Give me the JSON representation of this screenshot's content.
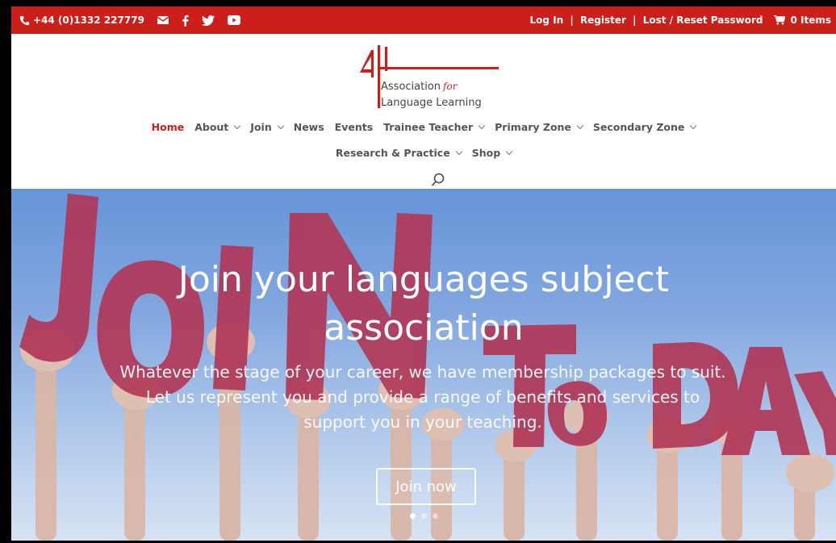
{
  "topbar": {
    "phone": "+44 (0)1332 227779",
    "social_icons": [
      "envelope-icon",
      "facebook-icon",
      "twitter-icon",
      "youtube-icon"
    ],
    "login": "Log In",
    "register": "Register",
    "reset": "Lost / Reset Password",
    "separator": "|",
    "cart_label": "0 Items",
    "bg_color": "#cc1f1a"
  },
  "logo": {
    "line1": "Association",
    "line1_for": "for",
    "line2": "Language Learning"
  },
  "nav": {
    "row1": [
      {
        "label": "Home",
        "active": true,
        "dropdown": false
      },
      {
        "label": "About",
        "dropdown": true
      },
      {
        "label": "Join",
        "dropdown": true
      },
      {
        "label": "News",
        "dropdown": false
      },
      {
        "label": "Events",
        "dropdown": false
      },
      {
        "label": "Trainee Teacher",
        "dropdown": true
      },
      {
        "label": "Primary Zone",
        "dropdown": true
      },
      {
        "label": "Secondary Zone",
        "dropdown": true
      }
    ],
    "row2": [
      {
        "label": "Research & Practice",
        "dropdown": true
      },
      {
        "label": "Shop",
        "dropdown": true
      }
    ],
    "search_icon": "search-icon",
    "active_color": "#cc1f1a"
  },
  "hero": {
    "title_line1": "Join your languages subject",
    "title_line2": "association",
    "description": "Whatever the stage of your career, we have membership packages to suit.  Let us represent you and provide a range of benefits and services to support you in your teaching.",
    "button_label": "Join now",
    "slide_count": 3,
    "active_slide": 0,
    "background_image": "hands-holding-join-today-letters"
  }
}
